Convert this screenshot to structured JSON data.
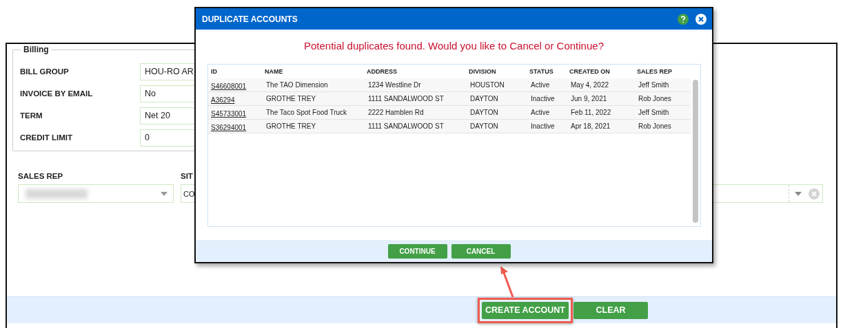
{
  "form": {
    "billing": {
      "legend": "Billing",
      "fields": [
        {
          "label": "BILL GROUP",
          "value": "HOU-RO AR"
        },
        {
          "label": "INVOICE BY EMAIL",
          "value": "No"
        },
        {
          "label": "TERM",
          "value": "Net 20"
        },
        {
          "label": "CREDIT LIMIT",
          "value": "0"
        }
      ]
    },
    "lower_fields": [
      {
        "kind": "blurred",
        "label": "SALES REP"
      },
      {
        "kind": "text",
        "label": "SIT",
        "value": "CO"
      },
      {
        "kind": "clearable"
      }
    ],
    "footer_buttons": [
      {
        "label": "CREATE ACCOUNT",
        "highlighted": true
      },
      {
        "label": "CLEAR",
        "highlighted": false
      }
    ]
  },
  "dialog": {
    "title": "DUPLICATE ACCOUNTS",
    "message": "Potential duplicates found. Would you like to Cancel or Continue?",
    "table": {
      "columns": [
        "ID",
        "NAME",
        "ADDRESS",
        "DIVISION",
        "STATUS",
        "CREATED ON",
        "SALES REP"
      ],
      "rows": [
        [
          "S46608001",
          "The TAO Dimension",
          "1234 Westline Dr",
          "HOUSTON",
          "Active",
          "May 4, 2022",
          "Jeff Smith"
        ],
        [
          "A36294",
          "GROTHE TREY",
          "1111 SANDALWOOD ST",
          "DAYTON",
          "Inactive",
          "Jun 9, 2021",
          "Rob Jones"
        ],
        [
          "S45733001",
          "The Taco Spot Food Truck",
          "2222 Hamblen Rd",
          "DAYTON",
          "Active",
          "Feb 11, 2022",
          "Jeff Smith"
        ],
        [
          "S36294001",
          "GROTHE TREY",
          "1111 SANDALWOOD ST",
          "DAYTON",
          "Inactive",
          "Apr 18, 2021",
          "Rob Jones"
        ]
      ]
    },
    "buttons": [
      "CONTINUE",
      "CANCEL"
    ]
  }
}
